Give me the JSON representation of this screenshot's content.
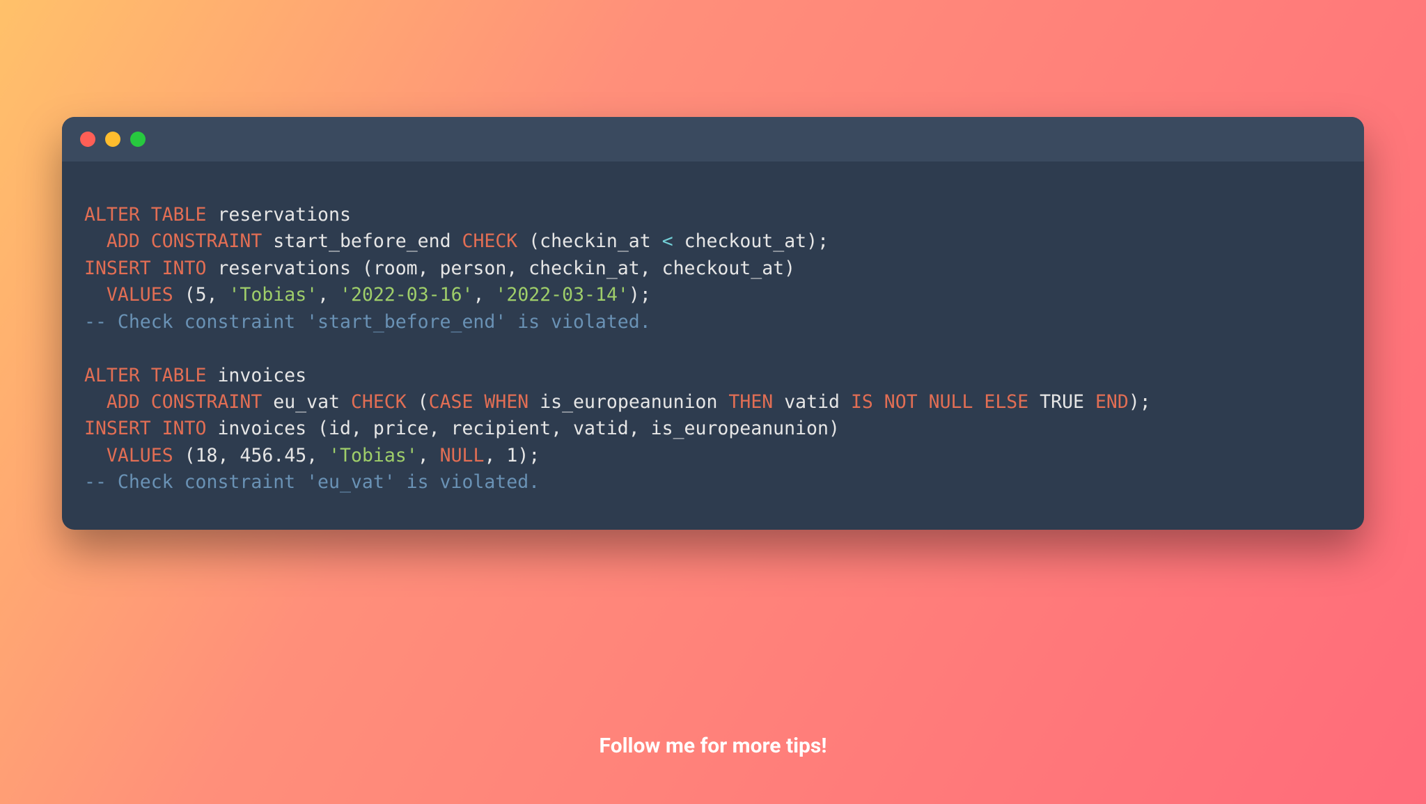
{
  "caption": "Follow me for more tips!",
  "code": {
    "lines": [
      [
        {
          "cls": "kw-orange",
          "txt": "ALTER TABLE"
        },
        {
          "cls": "kw-white",
          "txt": " reservations"
        }
      ],
      [
        {
          "cls": "kw-white",
          "txt": "  "
        },
        {
          "cls": "kw-orange",
          "txt": "ADD CONSTRAINT"
        },
        {
          "cls": "kw-white",
          "txt": " start_before_end "
        },
        {
          "cls": "kw-orange",
          "txt": "CHECK"
        },
        {
          "cls": "kw-white",
          "txt": " (checkin_at "
        },
        {
          "cls": "kw-cyan",
          "txt": "<"
        },
        {
          "cls": "kw-white",
          "txt": " checkout_at);"
        }
      ],
      [
        {
          "cls": "kw-orange",
          "txt": "INSERT INTO"
        },
        {
          "cls": "kw-white",
          "txt": " reservations (room, person, checkin_at, checkout_at)"
        }
      ],
      [
        {
          "cls": "kw-white",
          "txt": "  "
        },
        {
          "cls": "kw-orange",
          "txt": "VALUES"
        },
        {
          "cls": "kw-white",
          "txt": " ("
        },
        {
          "cls": "kw-num",
          "txt": "5"
        },
        {
          "cls": "kw-white",
          "txt": ", "
        },
        {
          "cls": "kw-green",
          "txt": "'Tobias'"
        },
        {
          "cls": "kw-white",
          "txt": ", "
        },
        {
          "cls": "kw-green",
          "txt": "'2022-03-16'"
        },
        {
          "cls": "kw-white",
          "txt": ", "
        },
        {
          "cls": "kw-green",
          "txt": "'2022-03-14'"
        },
        {
          "cls": "kw-white",
          "txt": ");"
        }
      ],
      [
        {
          "cls": "kw-comment",
          "txt": "-- Check constraint 'start_before_end' is violated."
        }
      ],
      [
        {
          "cls": "kw-white",
          "txt": " "
        }
      ],
      [
        {
          "cls": "kw-orange",
          "txt": "ALTER TABLE"
        },
        {
          "cls": "kw-white",
          "txt": " invoices"
        }
      ],
      [
        {
          "cls": "kw-white",
          "txt": "  "
        },
        {
          "cls": "kw-orange",
          "txt": "ADD CONSTRAINT"
        },
        {
          "cls": "kw-white",
          "txt": " eu_vat "
        },
        {
          "cls": "kw-orange",
          "txt": "CHECK"
        },
        {
          "cls": "kw-white",
          "txt": " ("
        },
        {
          "cls": "kw-orange",
          "txt": "CASE WHEN"
        },
        {
          "cls": "kw-white",
          "txt": " is_europeanunion "
        },
        {
          "cls": "kw-orange",
          "txt": "THEN"
        },
        {
          "cls": "kw-white",
          "txt": " vatid "
        },
        {
          "cls": "kw-orange",
          "txt": "IS NOT NULL ELSE"
        },
        {
          "cls": "kw-white",
          "txt": " TRUE "
        },
        {
          "cls": "kw-orange",
          "txt": "END"
        },
        {
          "cls": "kw-white",
          "txt": ");"
        }
      ],
      [
        {
          "cls": "kw-orange",
          "txt": "INSERT INTO"
        },
        {
          "cls": "kw-white",
          "txt": " invoices (id, price, recipient, vatid, is_europeanunion)"
        }
      ],
      [
        {
          "cls": "kw-white",
          "txt": "  "
        },
        {
          "cls": "kw-orange",
          "txt": "VALUES"
        },
        {
          "cls": "kw-white",
          "txt": " ("
        },
        {
          "cls": "kw-num",
          "txt": "18"
        },
        {
          "cls": "kw-white",
          "txt": ", "
        },
        {
          "cls": "kw-num",
          "txt": "456.45"
        },
        {
          "cls": "kw-white",
          "txt": ", "
        },
        {
          "cls": "kw-green",
          "txt": "'Tobias'"
        },
        {
          "cls": "kw-white",
          "txt": ", "
        },
        {
          "cls": "kw-orange",
          "txt": "NULL"
        },
        {
          "cls": "kw-white",
          "txt": ", "
        },
        {
          "cls": "kw-num",
          "txt": "1"
        },
        {
          "cls": "kw-white",
          "txt": ");"
        }
      ],
      [
        {
          "cls": "kw-comment",
          "txt": "-- Check constraint 'eu_vat' is violated."
        }
      ]
    ]
  }
}
